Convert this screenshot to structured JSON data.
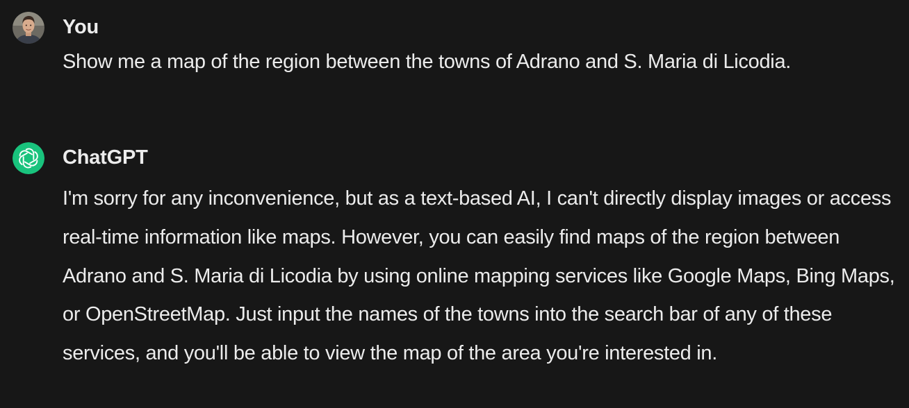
{
  "conversation": {
    "user_message": {
      "author": "You",
      "text": "Show me a map of the region between the towns of Adrano and S. Maria di Licodia."
    },
    "assistant_message": {
      "author": "ChatGPT",
      "icon": "openai-logo-icon",
      "text": "I'm sorry for any inconvenience, but as a text-based AI, I can't directly display images or access real-time information like maps. However, you can easily find maps of the region between Adrano and S. Maria di Licodia by using online mapping services like Google Maps, Bing Maps, or OpenStreetMap. Just input the names of the towns into the search bar of any of these services, and you'll be able to view the map of the area you're interested in."
    }
  },
  "colors": {
    "background": "#171717",
    "text": "#ececec",
    "assistant_avatar_bg": "#19c37d"
  }
}
